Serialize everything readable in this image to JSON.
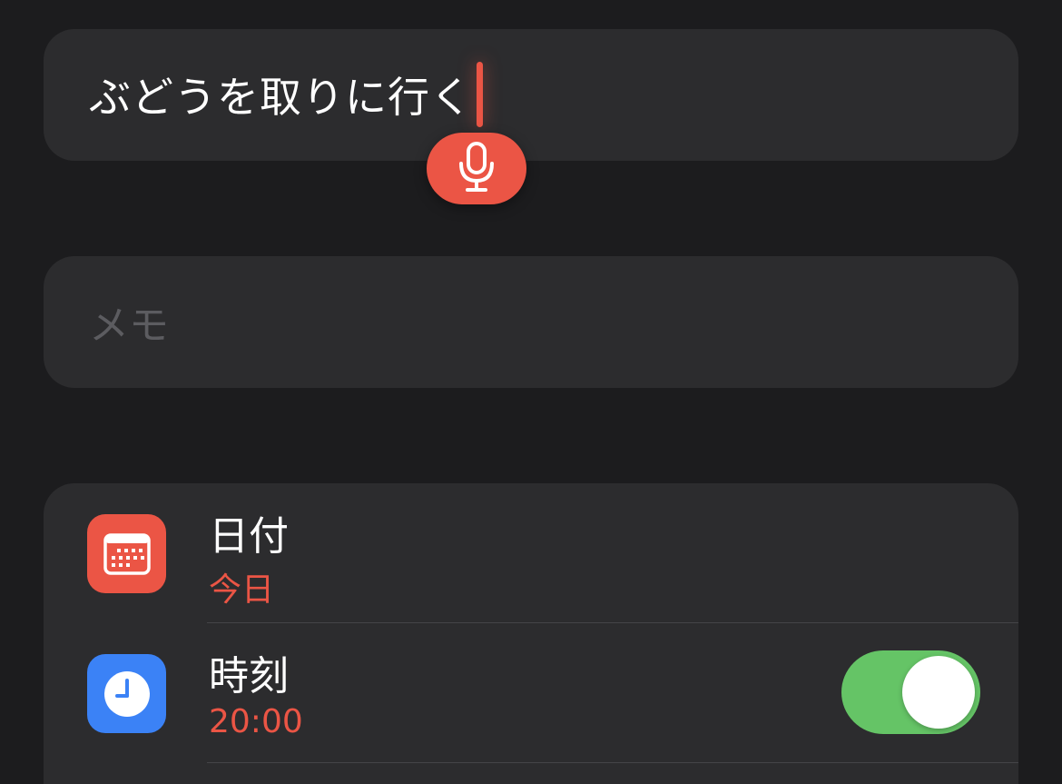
{
  "title_field": {
    "value": "ぶどうを取りに行く"
  },
  "dictation": {
    "icon": "microphone-icon",
    "accent_color": "#eb5545"
  },
  "notes_field": {
    "placeholder": "メモ",
    "value": ""
  },
  "details": {
    "date": {
      "icon": "calendar-icon",
      "label": "日付",
      "value": "今日"
    },
    "time": {
      "icon": "clock-icon",
      "label": "時刻",
      "value": "20:00",
      "enabled": true
    }
  },
  "colors": {
    "background": "#1c1c1e",
    "card": "#2c2c2e",
    "accent_red": "#eb5545",
    "icon_blue": "#3b82f6",
    "toggle_on": "#65c466",
    "placeholder": "#5c5c60"
  }
}
